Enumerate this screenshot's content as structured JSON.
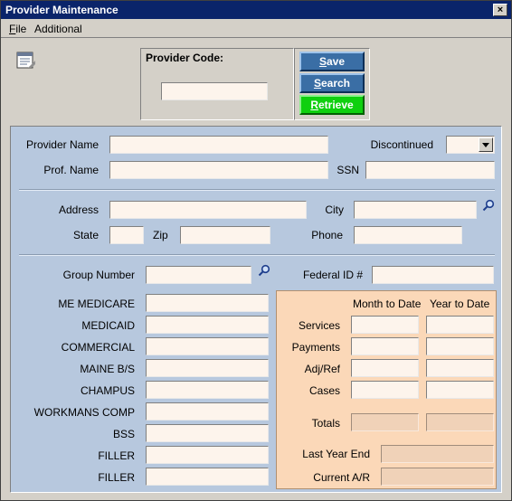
{
  "window": {
    "title": "Provider Maintenance",
    "close_glyph": "×"
  },
  "menu": [
    {
      "label": "File",
      "mnemonic": "F",
      "rest": "ile"
    },
    {
      "label": "Additional",
      "mnemonic": "",
      "rest": "Additional"
    }
  ],
  "icons": {
    "form": "form-icon",
    "search": "search-icon",
    "dropdown": "chevron-down-icon",
    "close": "close-icon"
  },
  "code_panel": {
    "label": "Provider Code:",
    "value": ""
  },
  "buttons": {
    "save": {
      "mnemonic": "S",
      "rest": "ave"
    },
    "search": {
      "mnemonic": "S",
      "rest": "earch"
    },
    "retrieve": {
      "mnemonic": "R",
      "rest": "etrieve"
    }
  },
  "colors": {
    "save_bg": "#3a6ea5",
    "retrieve_bg": "#0fd00f",
    "panel_bg": "#b7c8de",
    "stats_bg": "#fbd8b8",
    "title_bg": "#0a246a"
  },
  "provider": {
    "name_label": "Provider Name",
    "name_value": "",
    "discontinued_label": "Discontinued",
    "discontinued_value": "",
    "prof_name_label": "Prof. Name",
    "prof_name_value": "",
    "ssn_label": "SSN",
    "ssn_value": "",
    "address_label": "Address",
    "address_value": "",
    "city_label": "City",
    "city_value": "",
    "state_label": "State",
    "state_value": "",
    "zip_label": "Zip",
    "zip_value": "",
    "phone_label": "Phone",
    "phone_value": "",
    "group_label": "Group Number",
    "group_value": "",
    "federal_id_label": "Federal ID #",
    "federal_id_value": ""
  },
  "payers": [
    {
      "label": "ME MEDICARE",
      "value": ""
    },
    {
      "label": "MEDICAID",
      "value": ""
    },
    {
      "label": "COMMERCIAL",
      "value": ""
    },
    {
      "label": "MAINE B/S",
      "value": ""
    },
    {
      "label": "CHAMPUS",
      "value": ""
    },
    {
      "label": "WORKMANS COMP",
      "value": ""
    },
    {
      "label": "BSS",
      "value": ""
    },
    {
      "label": "FILLER",
      "value": ""
    },
    {
      "label": "FILLER",
      "value": ""
    }
  ],
  "stats": {
    "col_mtd": "Month to Date",
    "col_ytd": "Year to Date",
    "rows": [
      {
        "label": "Services",
        "mtd": "",
        "ytd": ""
      },
      {
        "label": "Payments",
        "mtd": "",
        "ytd": ""
      },
      {
        "label": "Adj/Ref",
        "mtd": "",
        "ytd": ""
      },
      {
        "label": "Cases",
        "mtd": "",
        "ytd": ""
      }
    ],
    "totals_label": "Totals",
    "totals_mtd": "",
    "totals_ytd": "",
    "last_year_end_label": "Last Year End",
    "last_year_end_value": "",
    "current_ar_label": "Current A/R",
    "current_ar_value": ""
  }
}
